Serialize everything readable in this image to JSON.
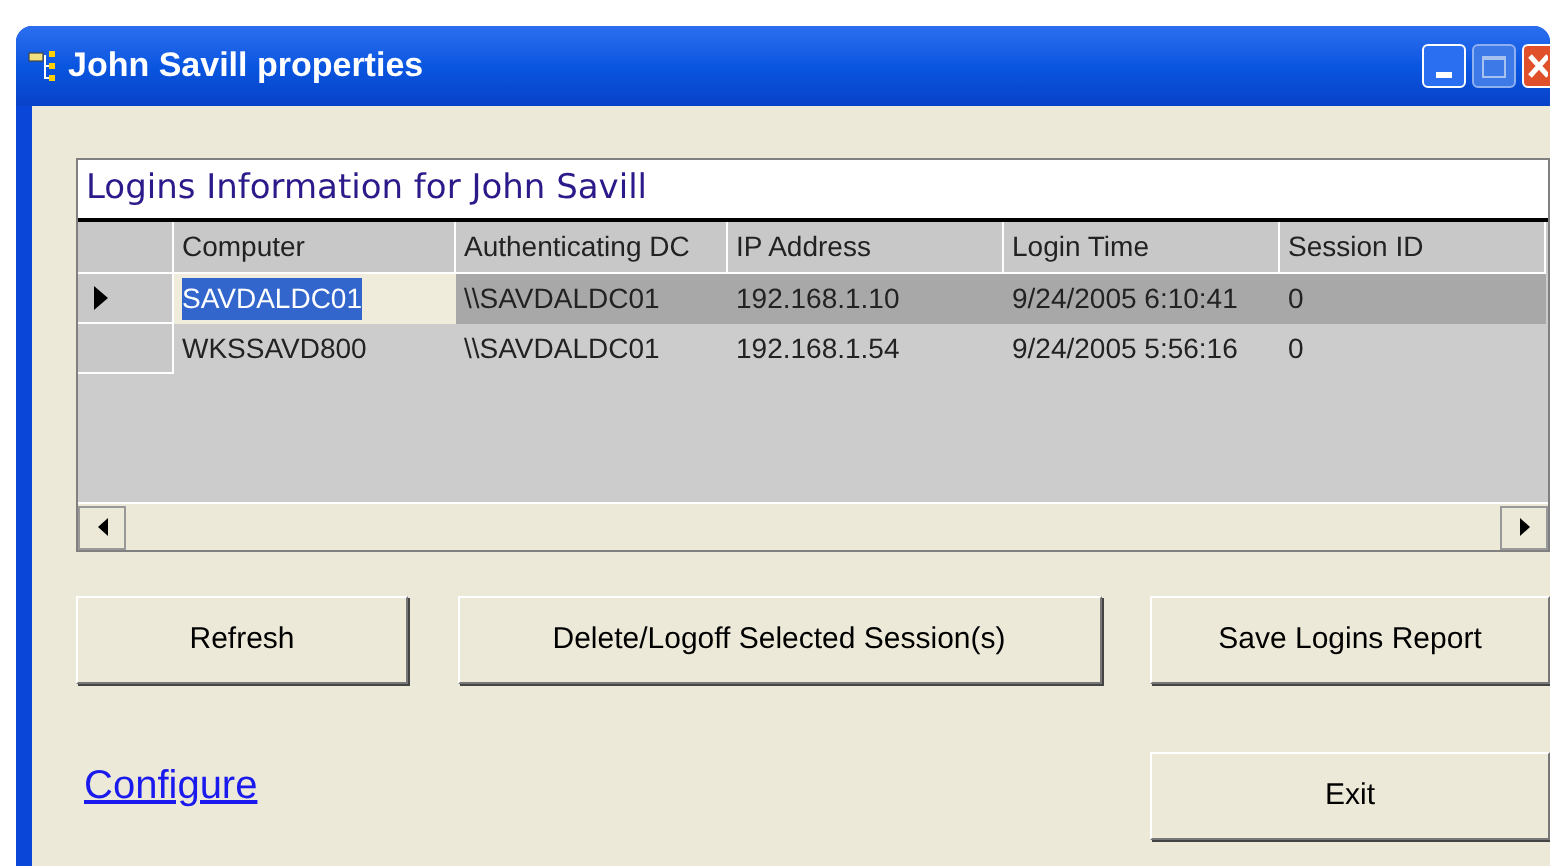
{
  "window": {
    "title": "John Savill properties"
  },
  "grid": {
    "caption": "Logins Information for John Savill",
    "columns": [
      "Computer",
      "Authenticating DC",
      "IP Address",
      "Login Time",
      "Session ID"
    ],
    "rows": [
      {
        "selected": true,
        "cells": [
          "SAVDALDC01",
          "\\\\SAVDALDC01",
          "192.168.1.10",
          "9/24/2005 6:10:41",
          "0"
        ]
      },
      {
        "selected": false,
        "cells": [
          "WKSSAVD800",
          "\\\\SAVDALDC01",
          "192.168.1.54",
          "9/24/2005 5:56:16",
          "0"
        ]
      }
    ]
  },
  "buttons": [
    "Refresh",
    "Delete/Logoff Selected Session(s)",
    "Save Logins Report"
  ],
  "link": "Configure",
  "exit_button": "Exit"
}
